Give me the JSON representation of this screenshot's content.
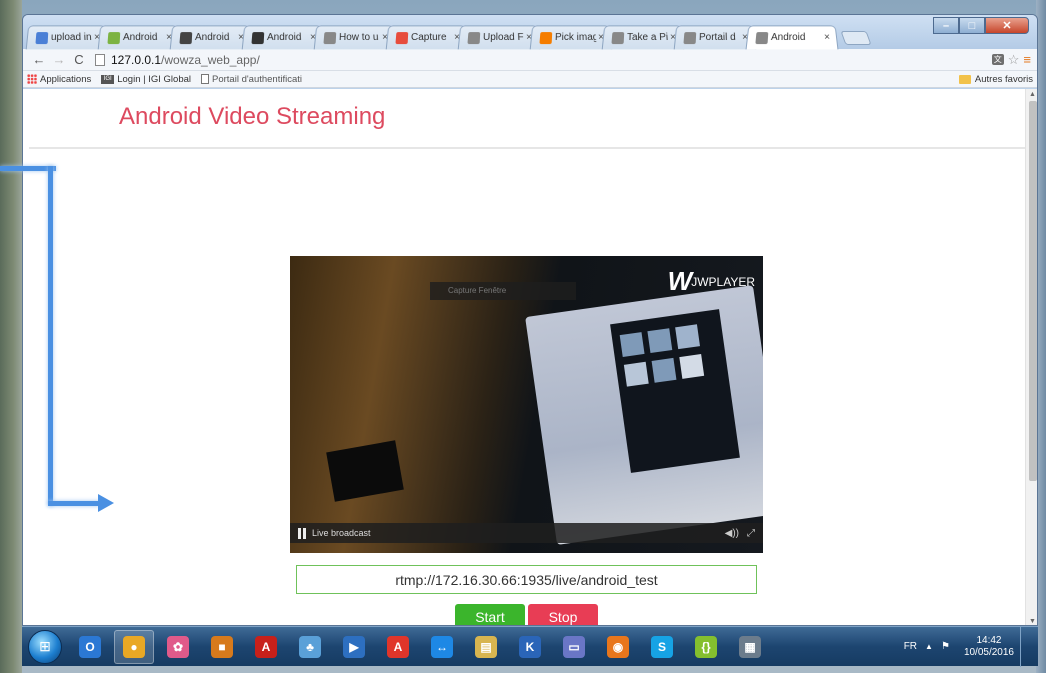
{
  "browser": {
    "tabs": [
      {
        "label": "upload in",
        "icon": "google-icon",
        "color": "#4a7fd6"
      },
      {
        "label": "Android",
        "icon": "android-icon",
        "color": "#7cb342"
      },
      {
        "label": "Android",
        "icon": "mail-icon",
        "color": "#444444"
      },
      {
        "label": "Android",
        "icon": "code-icon",
        "color": "#333333"
      },
      {
        "label": "How to u",
        "icon": "page-icon",
        "color": "#888888"
      },
      {
        "label": "Capture",
        "icon": "scissors-icon",
        "color": "#e74c3c"
      },
      {
        "label": "Upload F",
        "icon": "page-icon",
        "color": "#888888"
      },
      {
        "label": "Pick imag",
        "icon": "blogger-icon",
        "color": "#f57d00"
      },
      {
        "label": "Take a Pi",
        "icon": "page-icon",
        "color": "#888888"
      },
      {
        "label": "Portail d",
        "icon": "page-icon",
        "color": "#888888"
      },
      {
        "label": "Android",
        "icon": "page-icon",
        "color": "#888888",
        "active": true
      }
    ],
    "close_glyph": "×",
    "url_host": "127.0.0.1",
    "url_path": "/wowza_web_app/",
    "bookmarks": {
      "apps": "Applications",
      "igi": "Login | IGI Global",
      "portal": "Portail d'authentificati",
      "other": "Autres favoris"
    }
  },
  "page": {
    "title": "Android Video Streaming",
    "player": {
      "brand": "JWPLAYER",
      "brand_mark": "W",
      "live_label": "Live broadcast",
      "caption": "Capture Fenêtre"
    },
    "stream_url": "rtmp://172.16.30.66:1935/live/android_test",
    "start_label": "Start",
    "stop_label": "Stop"
  },
  "taskbar": {
    "apps": [
      {
        "name": "outlook-icon",
        "glyph": "O",
        "color": "#2b78d4"
      },
      {
        "name": "chrome-icon",
        "glyph": "●",
        "color": "#e9a825",
        "active": true
      },
      {
        "name": "photos-icon",
        "glyph": "✿",
        "color": "#e05a8a"
      },
      {
        "name": "box-icon",
        "glyph": "■",
        "color": "#d77a1c"
      },
      {
        "name": "acrobat-icon",
        "glyph": "A",
        "color": "#c8201a"
      },
      {
        "name": "network-icon",
        "glyph": "♣",
        "color": "#5aa0d8"
      },
      {
        "name": "media-icon",
        "glyph": "▶",
        "color": "#2d6fc0"
      },
      {
        "name": "pdf-icon",
        "glyph": "A",
        "color": "#e0352a"
      },
      {
        "name": "teamviewer-icon",
        "glyph": "↔",
        "color": "#1e88e5"
      },
      {
        "name": "files-icon",
        "glyph": "▤",
        "color": "#d8b550"
      },
      {
        "name": "app-icon",
        "glyph": "K",
        "color": "#2a65b8"
      },
      {
        "name": "notes-icon",
        "glyph": "▭",
        "color": "#6a76c6"
      },
      {
        "name": "firefox-icon",
        "glyph": "◉",
        "color": "#e8761c"
      },
      {
        "name": "skype-icon",
        "glyph": "S",
        "color": "#16a3e5"
      },
      {
        "name": "brackets-icon",
        "glyph": "{}",
        "color": "#84bf2e"
      },
      {
        "name": "document-icon",
        "glyph": "▦",
        "color": "#6c7c8c"
      }
    ],
    "lang": "FR",
    "time": "14:42",
    "date": "10/05/2016"
  }
}
